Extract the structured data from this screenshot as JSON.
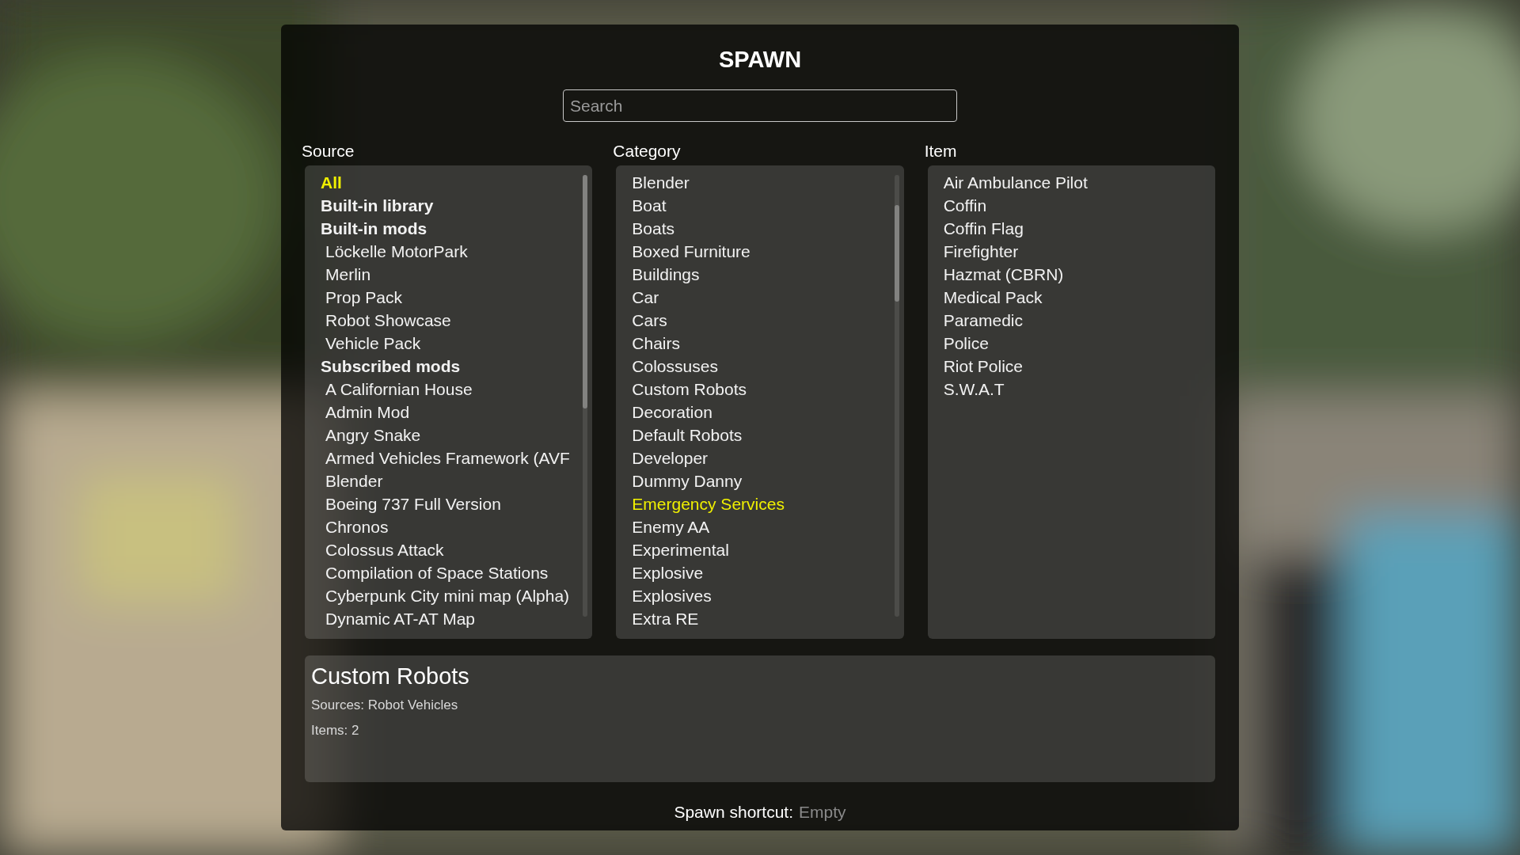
{
  "window": {
    "title": "SPAWN"
  },
  "search": {
    "placeholder": "Search"
  },
  "source": {
    "label": "Source",
    "items": [
      {
        "label": "All",
        "kind": "heading",
        "selected": true
      },
      {
        "label": "Built-in library",
        "kind": "heading",
        "selected": false
      },
      {
        "label": "Built-in mods",
        "kind": "heading",
        "selected": false
      },
      {
        "label": "Löckelle MotorPark",
        "kind": "entry",
        "selected": false
      },
      {
        "label": "Merlin",
        "kind": "entry",
        "selected": false
      },
      {
        "label": "Prop Pack",
        "kind": "entry",
        "selected": false
      },
      {
        "label": "Robot Showcase",
        "kind": "entry",
        "selected": false
      },
      {
        "label": "Vehicle Pack",
        "kind": "entry",
        "selected": false
      },
      {
        "label": "Subscribed mods",
        "kind": "heading",
        "selected": false
      },
      {
        "label": "A Californian House",
        "kind": "entry",
        "selected": false
      },
      {
        "label": "Admin Mod",
        "kind": "entry",
        "selected": false
      },
      {
        "label": "Angry Snake",
        "kind": "entry",
        "selected": false
      },
      {
        "label": "Armed Vehicles Framework (AVF",
        "kind": "entry",
        "selected": false
      },
      {
        "label": "Blender",
        "kind": "entry",
        "selected": false
      },
      {
        "label": "Boeing 737 Full Version",
        "kind": "entry",
        "selected": false
      },
      {
        "label": "Chronos",
        "kind": "entry",
        "selected": false
      },
      {
        "label": "Colossus Attack",
        "kind": "entry",
        "selected": false
      },
      {
        "label": "Compilation of Space Stations",
        "kind": "entry",
        "selected": false
      },
      {
        "label": "Cyberpunk City mini map (Alpha)",
        "kind": "entry",
        "selected": false
      },
      {
        "label": "Dynamic AT-AT Map",
        "kind": "entry",
        "selected": false
      }
    ]
  },
  "category": {
    "label": "Category",
    "items": [
      {
        "label": "Blender",
        "selected": false
      },
      {
        "label": "Boat",
        "selected": false
      },
      {
        "label": "Boats",
        "selected": false
      },
      {
        "label": "Boxed Furniture",
        "selected": false
      },
      {
        "label": "Buildings",
        "selected": false
      },
      {
        "label": "Car",
        "selected": false
      },
      {
        "label": "Cars",
        "selected": false
      },
      {
        "label": "Chairs",
        "selected": false
      },
      {
        "label": "Colossuses",
        "selected": false
      },
      {
        "label": "Custom Robots",
        "selected": false
      },
      {
        "label": "Decoration",
        "selected": false
      },
      {
        "label": "Default Robots",
        "selected": false
      },
      {
        "label": "Developer",
        "selected": false
      },
      {
        "label": "Dummy Danny",
        "selected": false
      },
      {
        "label": "Emergency Services",
        "selected": true
      },
      {
        "label": "Enemy AA",
        "selected": false
      },
      {
        "label": "Experimental",
        "selected": false
      },
      {
        "label": "Explosive",
        "selected": false
      },
      {
        "label": "Explosives",
        "selected": false
      },
      {
        "label": "Extra RE",
        "selected": false
      }
    ]
  },
  "item": {
    "label": "Item",
    "items": [
      {
        "label": "Air Ambulance Pilot",
        "selected": false
      },
      {
        "label": "Coffin",
        "selected": false
      },
      {
        "label": "Coffin Flag",
        "selected": false
      },
      {
        "label": "Firefighter",
        "selected": false
      },
      {
        "label": "Hazmat (CBRN)",
        "selected": false
      },
      {
        "label": "Medical Pack",
        "selected": false
      },
      {
        "label": "Paramedic",
        "selected": false
      },
      {
        "label": "Police",
        "selected": false
      },
      {
        "label": "Riot Police",
        "selected": false
      },
      {
        "label": "S.W.A.T",
        "selected": false
      }
    ]
  },
  "info": {
    "title": "Custom Robots",
    "lines": [
      "Sources: Robot Vehicles",
      "Items: 2"
    ]
  },
  "shortcut": {
    "label": "Spawn shortcut:",
    "value": "Empty"
  }
}
